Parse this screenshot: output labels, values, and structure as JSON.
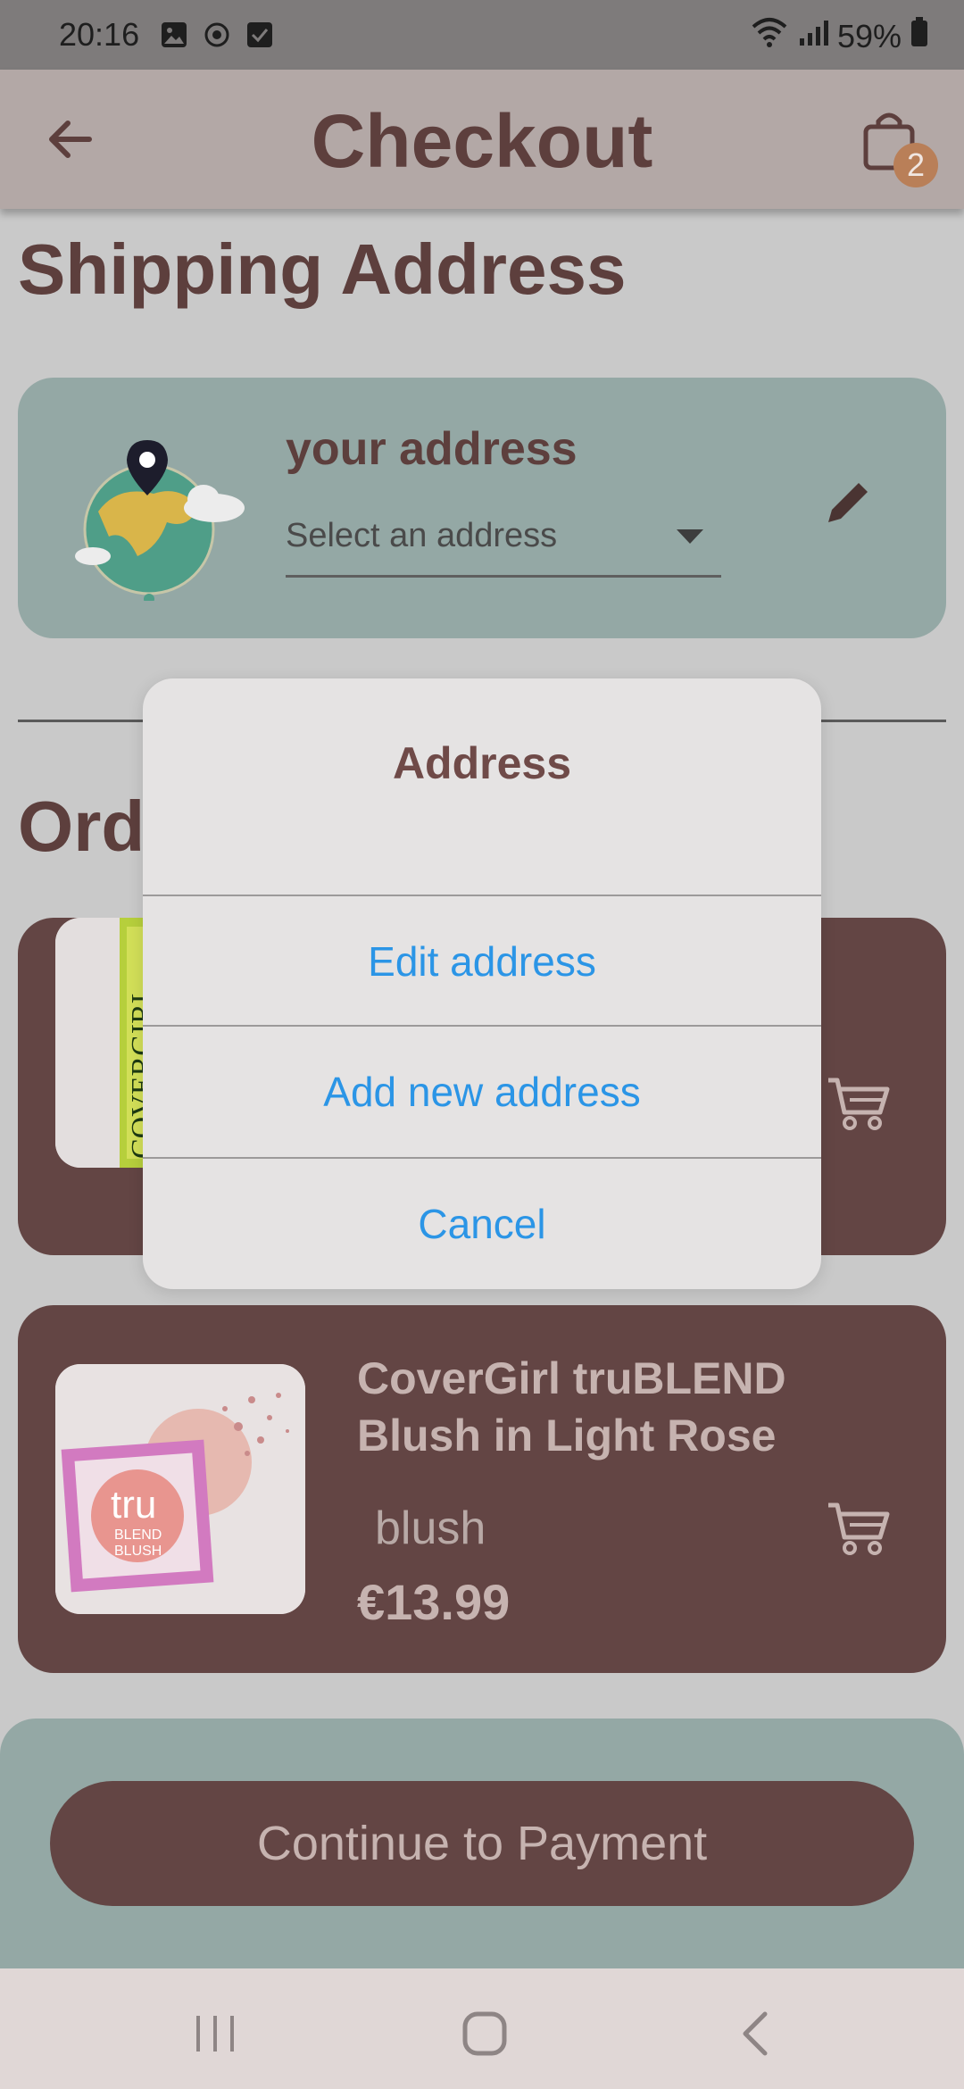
{
  "status_bar": {
    "time": "20:16",
    "battery": "59%"
  },
  "app_bar": {
    "title": "Checkout",
    "cart_count": "2"
  },
  "shipping": {
    "section_title": "Shipping Address",
    "address_label": "your address",
    "select_placeholder": "Select an address"
  },
  "orders": {
    "section_title_visible": "Ord",
    "items": [
      {
        "name": "",
        "category": "",
        "price": ""
      },
      {
        "name": "CoverGirl truBLEND Blush in Light Rose",
        "category": "blush",
        "price": "€13.99"
      }
    ]
  },
  "dialog": {
    "title": "Address",
    "actions": [
      "Edit address",
      "Add new address",
      "Cancel"
    ]
  },
  "footer": {
    "continue_label": "Continue to Payment"
  },
  "colors": {
    "brand_brown": "#634544",
    "title_brown": "#5d3f3d",
    "teal_card": "#94a8a5",
    "dialog_link": "#2b95e6",
    "badge": "#b97f58"
  },
  "icons": [
    "image-icon",
    "sync-icon",
    "check-box-icon",
    "wifi-icon",
    "signal-icon",
    "battery-icon",
    "back-arrow-icon",
    "shopping-bag-icon",
    "globe-pin-icon",
    "pencil-icon",
    "cart-icon",
    "recents-icon",
    "home-icon",
    "nav-back-icon"
  ]
}
